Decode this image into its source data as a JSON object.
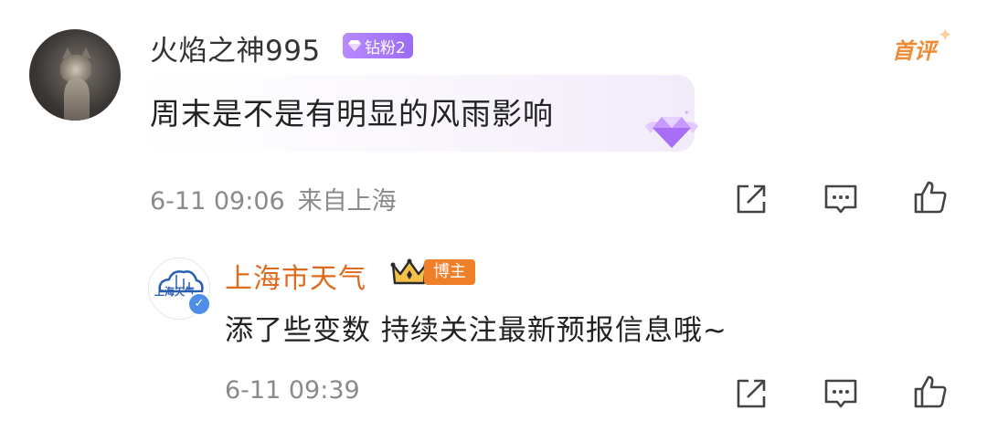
{
  "main_comment": {
    "username": "火焰之神995",
    "fan_badge": "钻粉2",
    "first_comment_tag": "首评",
    "text": "周末是不是有明显的风雨影响",
    "timestamp": "6-11 09:06",
    "location": "来自上海"
  },
  "reply": {
    "username": "上海市天气",
    "avatar_text": "上海天气",
    "role_badge": "博主",
    "text": "添了些变数 持续关注最新预报信息哦~",
    "timestamp": "6-11 09:39"
  },
  "icons": {
    "share": "share-icon",
    "comment": "comment-icon",
    "like": "like-icon"
  },
  "colors": {
    "reply_username": "#e06a1c",
    "role_badge_bg": "#f07f2a",
    "fan_badge_bg": "#9a6cf2",
    "first_comment_tag": "#f08a35",
    "meta_text": "#8a8a8a"
  }
}
